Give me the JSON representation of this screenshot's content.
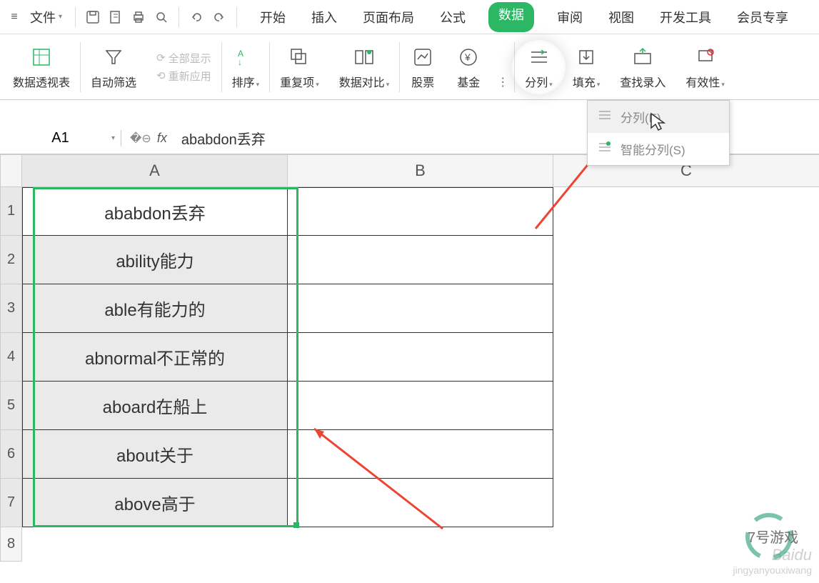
{
  "menubar": {
    "file": "文件"
  },
  "tabs": {
    "start": "开始",
    "insert": "插入",
    "layout": "页面布局",
    "formula": "公式",
    "data": "数据",
    "review": "审阅",
    "view": "视图",
    "dev": "开发工具",
    "vip": "会员专享"
  },
  "ribbon": {
    "pivot": "数据透视表",
    "autofilter": "自动筛选",
    "showall": "全部显示",
    "reapply": "重新应用",
    "sort": "排序",
    "dup": "重复项",
    "compare": "数据对比",
    "stock": "股票",
    "fund": "基金",
    "split": "分列",
    "fill": "填充",
    "find": "查找录入",
    "valid": "有效性"
  },
  "dropdown": {
    "item1": "分列(E)",
    "item2": "智能分列(S)"
  },
  "formula_bar": {
    "name_box": "A1",
    "value": "ababdon丢弃"
  },
  "columns": [
    "A",
    "B",
    "C"
  ],
  "rows": [
    "1",
    "2",
    "3",
    "4",
    "5",
    "6",
    "7",
    "8"
  ],
  "cells": {
    "a1": "ababdon丢弃",
    "a2": "ability能力",
    "a3": "able有能力的",
    "a4": "abnormal不正常的",
    "a5": "aboard在船上",
    "a6": "about关于",
    "a7": "above高于"
  },
  "watermark": {
    "line1": "Baidu",
    "line2": "jingyanyouxiwang",
    "line3": "7号游戏"
  }
}
